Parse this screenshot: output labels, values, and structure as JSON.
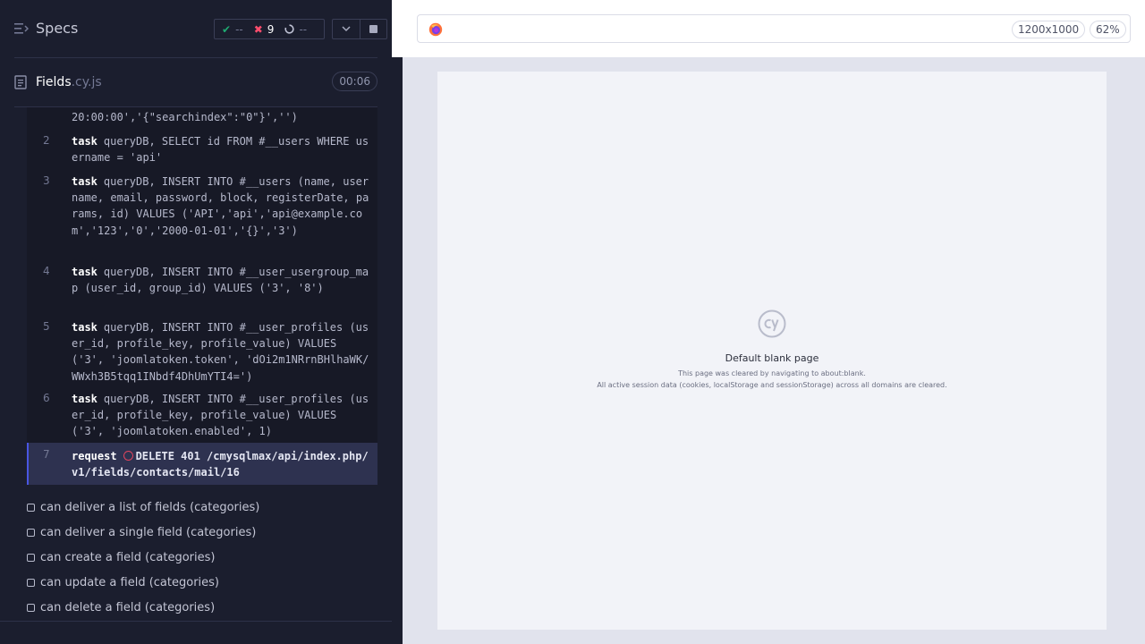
{
  "header": {
    "specs_label": "Specs",
    "stats": {
      "passed": "--",
      "failed": "9",
      "pending": "--"
    }
  },
  "file": {
    "name": "Fields",
    "ext": ".cy.js",
    "duration": "00:06"
  },
  "commands": [
    {
      "num": "",
      "name": "",
      "message": "20:00:00','{\"searchindex\":\"0\"}','')"
    },
    {
      "num": "2",
      "name": "task",
      "message": "queryDB, SELECT id FROM #__users WHERE username = 'api'"
    },
    {
      "num": "3",
      "name": "task",
      "message": "queryDB, INSERT INTO #__users (name, username, email, password, block, registerDate, params, id) VALUES ('API','api','api@example.com','123','0','2000-01-01','{}','3')"
    },
    {
      "num": "4",
      "name": "task",
      "message": "queryDB, INSERT INTO #__user_usergroup_map (user_id, group_id) VALUES ('3', '8')"
    },
    {
      "num": "5",
      "name": "task",
      "message": "queryDB, INSERT INTO #__user_profiles (user_id, profile_key, profile_value) VALUES ('3', 'joomlatoken.token', 'dOi2m1NRrnBHlhaWK/WWxh3B5tqq1INbdf4DhUmYTI4=')"
    },
    {
      "num": "6",
      "name": "task",
      "message": "queryDB, INSERT INTO #__user_profiles (user_id, profile_key, profile_value) VALUES ('3', 'joomlatoken.enabled', 1)"
    },
    {
      "num": "7",
      "name": "request",
      "message": "DELETE 401 /cmysqlmax/api/index.php/v1/fields/contacts/mail/16"
    }
  ],
  "tests": [
    "can deliver a list of fields (categories)",
    "can deliver a single field (categories)",
    "can create a field (categories)",
    "can update a field (categories)",
    "can delete a field (categories)"
  ],
  "aut": {
    "viewport": "1200x1000",
    "zoom": "62%",
    "blank_title": "Default blank page",
    "blank_line1": "This page was cleared by navigating to about:blank.",
    "blank_line2": "All active session data (cookies, localStorage and sessionStorage) across all domains are cleared."
  },
  "colors": {
    "reporter_bg": "#1b1e2e",
    "pass": "#1fa971",
    "fail": "#ff4d6d",
    "accent": "#4956e3"
  },
  "icons": [
    "menu-icon",
    "check-icon",
    "x-icon",
    "spinner-icon",
    "chevron-down-icon",
    "stop-icon",
    "file-icon",
    "error-circle-icon",
    "checkbox-icon",
    "firefox-icon",
    "cypress-logo-icon"
  ]
}
